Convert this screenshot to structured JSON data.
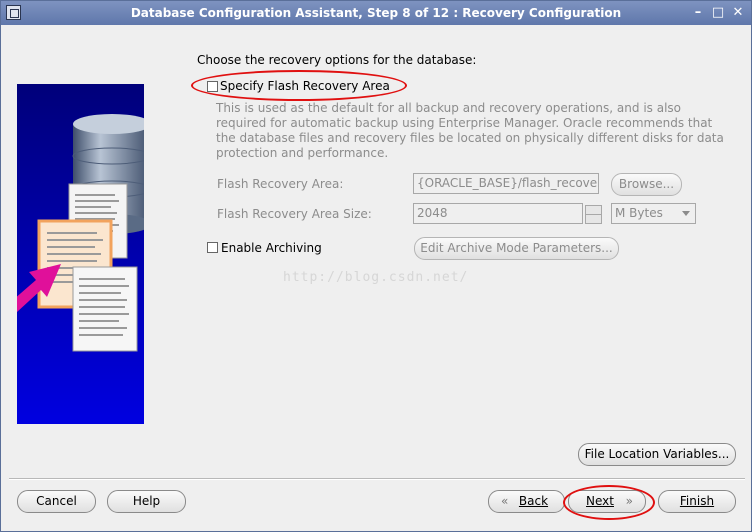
{
  "window": {
    "title": "Database Configuration Assistant, Step 8 of 12 : Recovery Configuration",
    "controls": {
      "minimize": "–",
      "maximize": "□",
      "close": "✕"
    }
  },
  "main": {
    "heading": "Choose the recovery options for the database:",
    "flash_recovery": {
      "checkbox_label": "Specify Flash Recovery Area",
      "checked": false,
      "description": "This is used as the default for all backup and recovery operations, and is also required for automatic backup using Enterprise Manager. Oracle recommends that the database files and recovery files be located on physically different disks for data protection and performance.",
      "area_label": "Flash Recovery Area:",
      "area_value": "{ORACLE_BASE}/flash_recovery_",
      "browse_label": "Browse...",
      "size_label": "Flash Recovery Area Size:",
      "size_value": "2048",
      "unit_value": "M Bytes"
    },
    "archiving": {
      "checkbox_label": "Enable Archiving",
      "checked": false,
      "edit_params_label": "Edit Archive Mode Parameters..."
    },
    "watermark": "http://blog.csdn.net/",
    "file_location_label": "File Location Variables..."
  },
  "footer": {
    "cancel": "Cancel",
    "help": "Help",
    "back": "Back",
    "next": "Next",
    "finish": "Finish"
  },
  "colors": {
    "titlebar": "#6b80b3",
    "annotation": "#e01010",
    "side_panel": "#0000c0"
  }
}
